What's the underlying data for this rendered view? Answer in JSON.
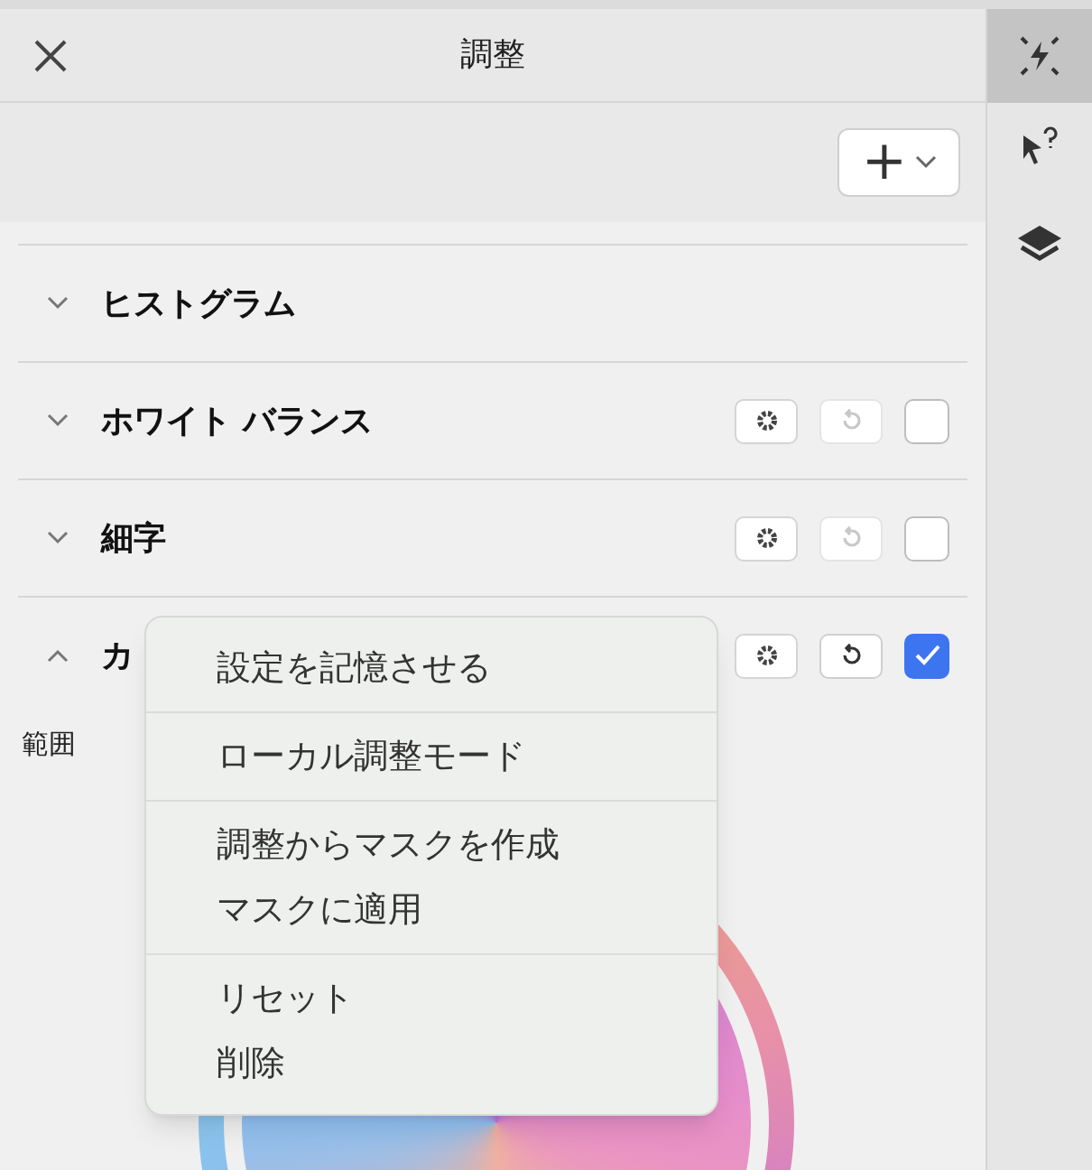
{
  "panel": {
    "title": "調整"
  },
  "toolbar": {
    "add_button": "+"
  },
  "sections": [
    {
      "label": "ヒストグラム",
      "expanded": false,
      "controls": false
    },
    {
      "label": "ホワイト バランス",
      "expanded": false,
      "controls": true,
      "reset_enabled": false,
      "checked": false
    },
    {
      "label": "細字",
      "expanded": false,
      "controls": true,
      "reset_enabled": false,
      "checked": false
    },
    {
      "label": "カ",
      "expanded": true,
      "controls": true,
      "reset_enabled": true,
      "checked": true
    }
  ],
  "range_label": "範囲",
  "context_menu": {
    "groups": [
      [
        "設定を記憶させる"
      ],
      [
        "ローカル調整モード"
      ],
      [
        "調整からマスクを作成",
        "マスクに適用"
      ],
      [
        "リセット",
        "削除"
      ]
    ]
  },
  "sidebar": {
    "tools": [
      {
        "kind": "adjust",
        "selected": true
      },
      {
        "kind": "inspect",
        "selected": false
      },
      {
        "kind": "layers",
        "selected": false
      }
    ]
  }
}
